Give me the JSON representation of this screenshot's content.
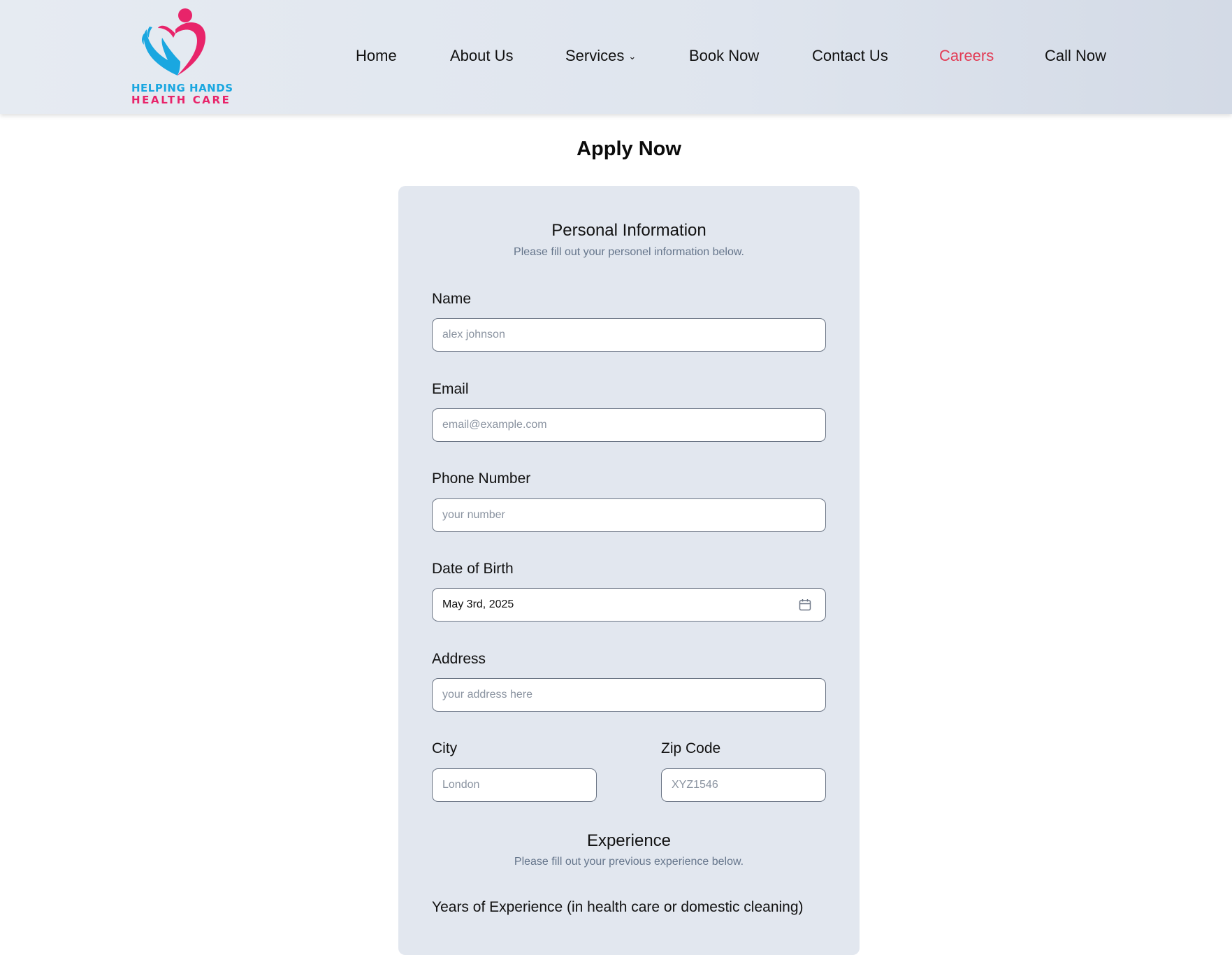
{
  "brand": {
    "line1": "HELPING HANDS",
    "line2": "HEALTH CARE",
    "colors": {
      "blue": "#1aa7e0",
      "pink": "#e8246a"
    }
  },
  "nav": {
    "items": [
      {
        "label": "Home"
      },
      {
        "label": "About Us"
      },
      {
        "label": "Services",
        "has_dropdown": true
      },
      {
        "label": "Book Now"
      },
      {
        "label": "Contact Us"
      },
      {
        "label": "Careers",
        "active": true
      },
      {
        "label": "Call Now"
      }
    ],
    "active_color": "#e23c55"
  },
  "page": {
    "title": "Apply Now"
  },
  "personal": {
    "title": "Personal Information",
    "subtitle": "Please fill out your personel information below.",
    "name": {
      "label": "Name",
      "placeholder": "alex johnson"
    },
    "email": {
      "label": "Email",
      "placeholder": "email@example.com"
    },
    "phone": {
      "label": "Phone Number",
      "placeholder": "your number"
    },
    "dob": {
      "label": "Date of Birth",
      "value": "May 3rd, 2025",
      "icon": "calendar-icon"
    },
    "address": {
      "label": "Address",
      "placeholder": "your address here"
    },
    "city": {
      "label": "City",
      "placeholder": "London"
    },
    "zip": {
      "label": "Zip Code",
      "placeholder": "XYZ1546"
    }
  },
  "experience": {
    "title": "Experience",
    "subtitle": "Please fill out your previous experience below.",
    "years_label": "Years of Experience (in health care or domestic cleaning)"
  }
}
